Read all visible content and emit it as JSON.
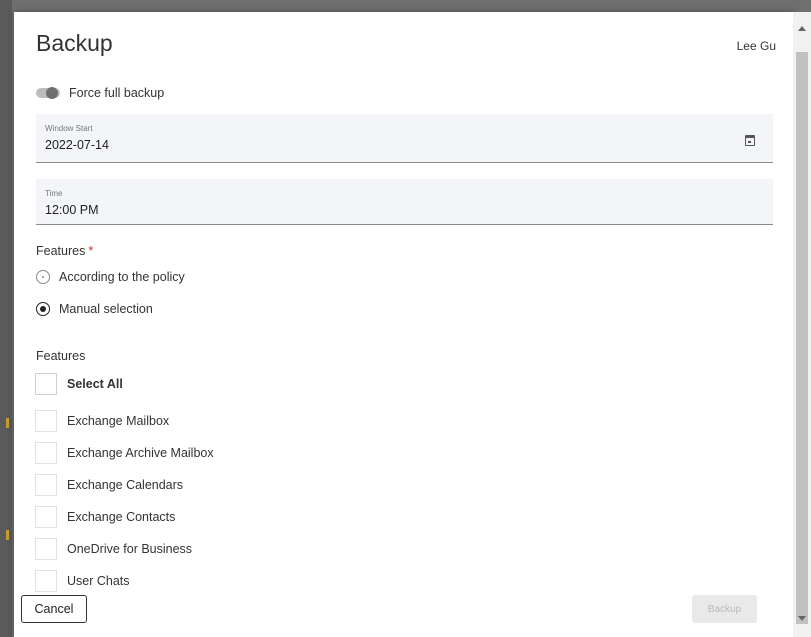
{
  "dialog": {
    "title": "Backup",
    "user": "Lee Gu"
  },
  "force_full_backup": {
    "label": "Force full backup",
    "enabled": false
  },
  "window_start": {
    "label": "Window Start",
    "value": "2022-07-14",
    "icon": "calendar-icon"
  },
  "time": {
    "label": "Time",
    "value": "12:00 PM"
  },
  "features_mode": {
    "label": "Features",
    "required_marker": "*",
    "options": [
      {
        "label": "According to the policy",
        "selected": false
      },
      {
        "label": "Manual selection",
        "selected": true
      }
    ]
  },
  "features": {
    "label": "Features",
    "select_all": "Select All",
    "items": [
      {
        "label": "Exchange Mailbox",
        "checked": false
      },
      {
        "label": "Exchange Archive Mailbox",
        "checked": false
      },
      {
        "label": "Exchange Calendars",
        "checked": false
      },
      {
        "label": "Exchange Contacts",
        "checked": false
      },
      {
        "label": "OneDrive for Business",
        "checked": false
      },
      {
        "label": "User Chats",
        "checked": false
      }
    ]
  },
  "footer": {
    "cancel_label": "Cancel",
    "backup_label": "Backup"
  },
  "colors": {
    "required": "#d32f2f",
    "field_bg": "#f3f5f8",
    "disabled_button": "#e9e9e9"
  }
}
